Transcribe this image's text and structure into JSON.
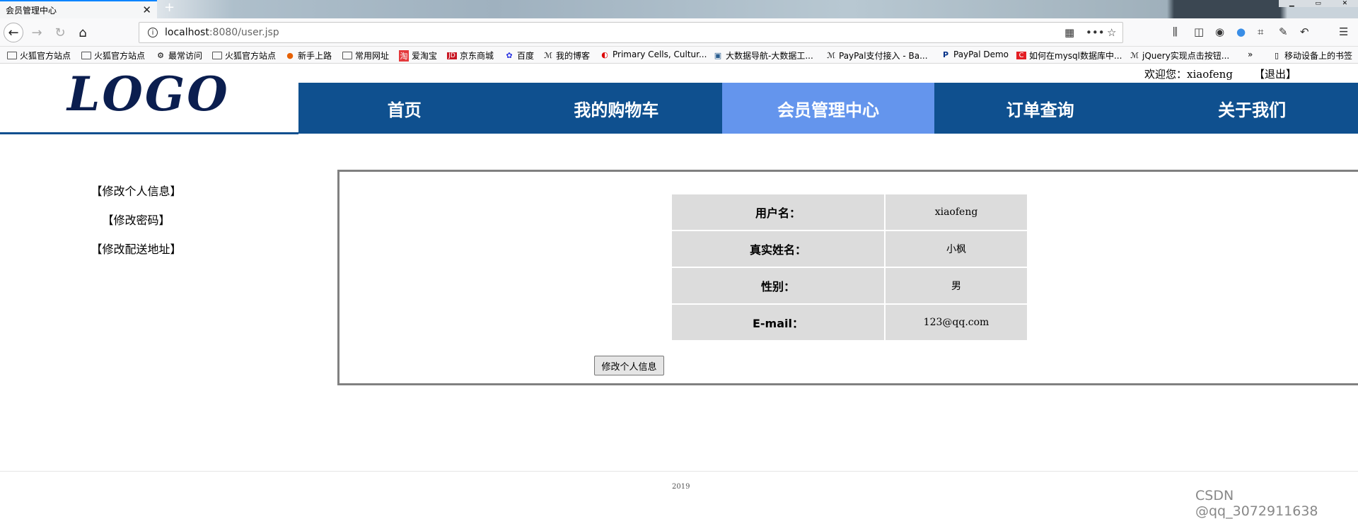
{
  "browser": {
    "tab_title": "会员管理中心",
    "tab_close": "✕",
    "new_tab": "+",
    "url_host": "localhost",
    "url_rest": ":8080/user.jsp"
  },
  "bookmarks": [
    "火狐官方站点",
    "火狐官方站点",
    "最常访问",
    "火狐官方站点",
    "新手上路",
    "常用网址",
    "爱淘宝",
    "京东商城",
    "百度",
    "我的博客",
    "Primary Cells, Cultur...",
    "大数据导航-大数据工...",
    "PayPal支付接入 - Ba...",
    "PayPal Demo",
    "如何在mysql数据库中...",
    "jQuery实现点击按钮...",
    "移动设备上的书签"
  ],
  "header": {
    "welcome": "欢迎您：xiaofeng",
    "logout": "【退出】",
    "logo": "LOGO"
  },
  "nav": [
    "首页",
    "我的购物车",
    "会员管理中心",
    "订单查询",
    "关于我们"
  ],
  "sidebar": [
    "【修改个人信息】",
    "【修改密码】",
    "【修改配送地址】"
  ],
  "profile": [
    {
      "label": "用户名：",
      "value": "xiaofeng"
    },
    {
      "label": "真实姓名：",
      "value": "小枫"
    },
    {
      "label": "性别：",
      "value": "男"
    },
    {
      "label": "E-mail：",
      "value": "123@qq.com"
    }
  ],
  "edit_button": "修改个人信息",
  "footer": {
    "copyright": "2019",
    "watermark": "CSDN @qq_3072911638"
  }
}
